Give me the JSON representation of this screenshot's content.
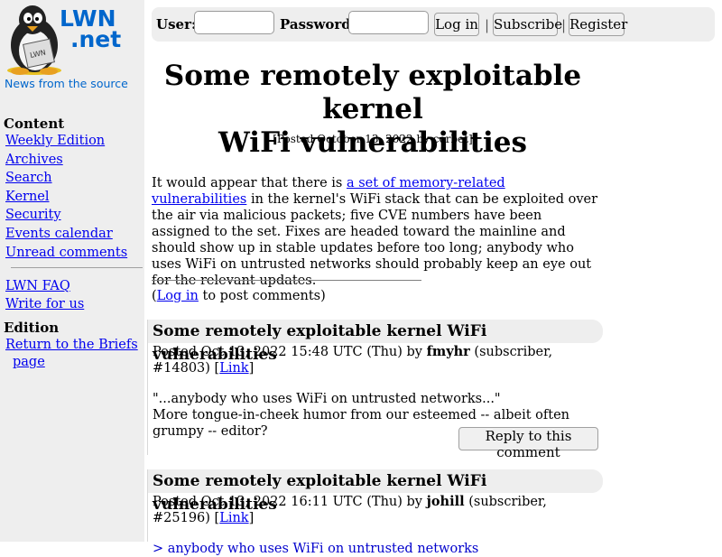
{
  "sidebar": {
    "logo_badge": "LWN",
    "logo_line1": "LWN",
    "logo_line2": ".net",
    "tagline": "News from the source",
    "content_heading": "Content",
    "content_links": [
      "Weekly Edition",
      "Archives",
      "Search",
      "Kernel",
      "Security",
      "Events calendar",
      "Unread comments"
    ],
    "extra_links": [
      "LWN FAQ",
      "Write for us"
    ],
    "edition_heading": "Edition",
    "edition_link_1": "Return to the Briefs",
    "edition_link_2": "page"
  },
  "login": {
    "user_label": "User:",
    "password_label": "Password:",
    "login_button": "Log in",
    "separator": "|",
    "subscribe_button": "Subscribe",
    "register_button": "Register"
  },
  "article": {
    "title_line1": "Some remotely exploitable kernel",
    "title_line2": "WiFi vulnerabilities",
    "byline": "[Posted October 13, 2022 by corbet]",
    "body_before_link": "It would appear that there is ",
    "body_link": "a set of memory-related vulnerabilities",
    "body_after_link": " in the kernel's WiFi stack that can be exploited over the air via malicious packets; five CVE numbers have been assigned to the set. Fixes are headed toward the mainline and should show up in stable updates before too long; anybody who uses WiFi on untrusted networks should probably keep an eye out for the relevant updates.",
    "login_link": "Log in",
    "login_suffix": " to post comments)",
    "open_paren": "("
  },
  "comments": [
    {
      "title": "Some remotely exploitable kernel WiFi vulnerabilities",
      "posted": "Posted Oct 13, 2022 15:48 UTC (Thu) by ",
      "author": "fmyhr",
      "subscriber": " (subscriber, #14803) [",
      "link": "Link",
      "close": "]",
      "line1": "\"...anybody who uses WiFi on untrusted networks...\"",
      "line2": "More tongue-in-cheek humor from our esteemed -- albeit often grumpy -- editor?",
      "reply_button": "Reply to this comment"
    },
    {
      "title": "Some remotely exploitable kernel WiFi vulnerabilities",
      "posted": "Posted Oct 13, 2022 16:11 UTC (Thu) by ",
      "author": "johill",
      "subscriber": " (subscriber, #25196) [",
      "link": "Link",
      "close": "]",
      "quote": "> anybody who uses WiFi on untrusted networks"
    }
  ]
}
